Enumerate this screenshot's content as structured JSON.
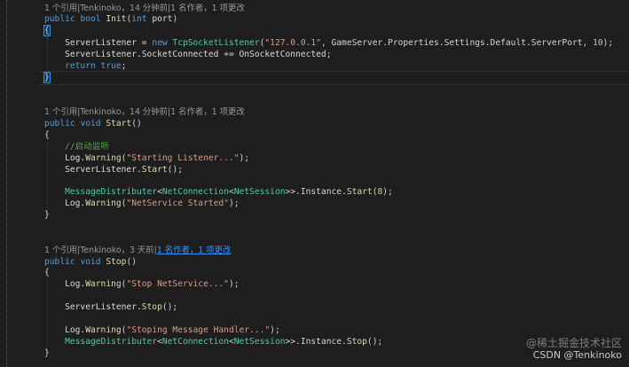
{
  "methods": [
    {
      "codelens_prefix": "1 个引用|Tenkinoko，14 分钟前|1 名作者，1 项更改",
      "signature": {
        "kw1": "public",
        "kw2": "bool",
        "name": "Init",
        "param_kw": "int",
        "param": "port"
      },
      "body": {
        "l1": {
          "obj": "ServerListener",
          "op": " = ",
          "kw": "new",
          "type": "TcpSocketListener",
          "str": "\"127.0.0.1\"",
          "mid": ", GameServer.Properties.Settings.Default.ServerPort, ",
          "num": "10",
          "end": ");"
        },
        "l2": {
          "obj": "ServerListener.",
          "member": "SocketConnected",
          "op": " += ",
          "handler": "OnSocketConnected",
          "end": ";"
        },
        "l3": {
          "kw": "return",
          "val": "true",
          "end": ";"
        }
      }
    },
    {
      "codelens_prefix": "1 个引用|Tenkinoko，14 分钟前|1 名作者，1 项更改",
      "signature": {
        "kw1": "public",
        "kw2": "void",
        "name": "Start",
        "args": "()"
      },
      "body": {
        "comment": "//启动监听",
        "l1": {
          "obj": "Log.",
          "fn": "Warning",
          "str": "\"Starting Listener...\"",
          "end": ");"
        },
        "l2": {
          "obj": "ServerListener.",
          "fn": "Start",
          "end": "();"
        },
        "l3": {
          "t1": "MessageDistributer",
          "t2": "NetConnection",
          "t3": "NetSession",
          "rest": ">>.Instance.",
          "fn": "Start",
          "num": "8",
          "end": ");"
        },
        "l4": {
          "obj": "Log.",
          "fn": "Warning",
          "str": "\"NetService Started\"",
          "end": ");"
        }
      }
    },
    {
      "codelens_prefix": "1 个引用|Tenkinoko，3 天前|",
      "codelens_link": "1 名作者，1 项更改",
      "signature": {
        "kw1": "public",
        "kw2": "void",
        "name": "Stop",
        "args": "()"
      },
      "body": {
        "l1": {
          "obj": "Log.",
          "fn": "Warning",
          "str": "\"Stop NetService...\"",
          "end": ");"
        },
        "l2": {
          "obj": "ServerListener.",
          "fn": "Stop",
          "end": "();"
        },
        "l3": {
          "obj": "Log.",
          "fn": "Warning",
          "str": "\"Stoping Message Handler...\"",
          "end": ");"
        },
        "l4": {
          "t1": "MessageDistributer",
          "t2": "NetConnection",
          "t3": "NetSession",
          "rest": ">>.Instance.",
          "fn": "Stop",
          "end": "();"
        }
      }
    }
  ],
  "braces": {
    "open": "{",
    "close": "}"
  },
  "watermark": {
    "line1": "@稀土掘金技术社区",
    "line2": "CSDN @Tenkinoko"
  }
}
